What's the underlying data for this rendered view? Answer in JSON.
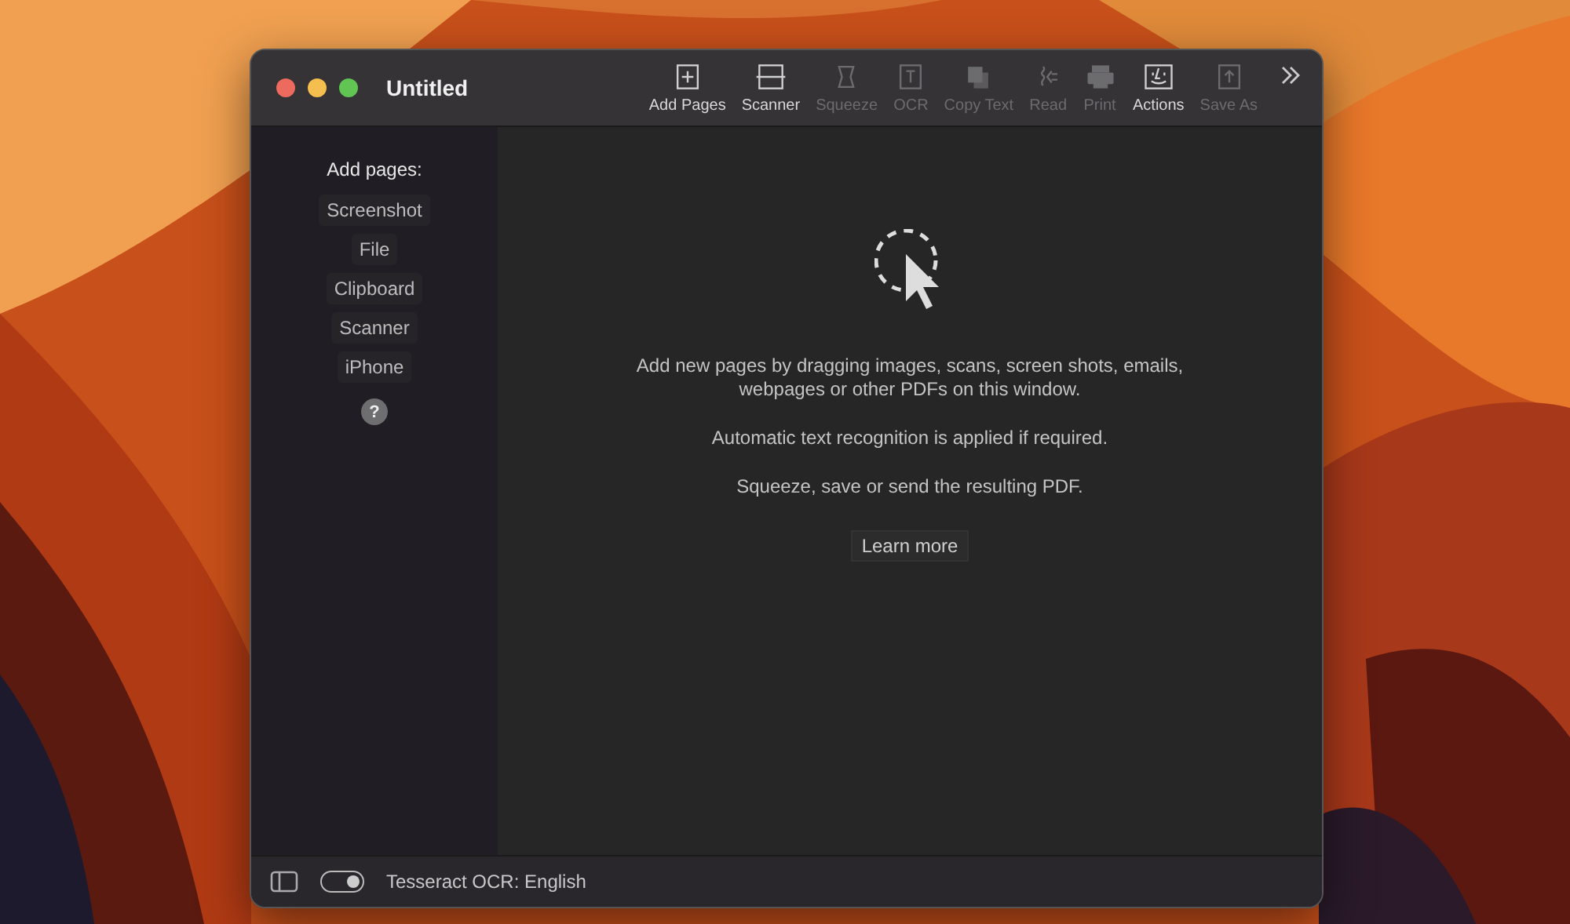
{
  "window": {
    "title": "Untitled"
  },
  "toolbar": [
    {
      "label": "Add Pages",
      "disabled": false
    },
    {
      "label": "Scanner",
      "disabled": false
    },
    {
      "label": "Squeeze",
      "disabled": true
    },
    {
      "label": "OCR",
      "disabled": true
    },
    {
      "label": "Copy Text",
      "disabled": true
    },
    {
      "label": "Read",
      "disabled": true
    },
    {
      "label": "Print",
      "disabled": true
    },
    {
      "label": "Actions",
      "disabled": false
    },
    {
      "label": "Save As",
      "disabled": true
    }
  ],
  "sidebar": {
    "heading": "Add pages:",
    "items": [
      "Screenshot",
      "File",
      "Clipboard",
      "Scanner",
      "iPhone"
    ],
    "help": "?"
  },
  "content": {
    "paragraphs": [
      "Add new pages by dragging images, scans, screen shots, emails, webpages or other PDFs on this window.",
      "Automatic text recognition is applied if required.",
      "Squeeze, save or send the resulting PDF."
    ],
    "button": "Learn more"
  },
  "status_bar": {
    "ocr_toggle": {
      "on": true
    },
    "label": "Tesseract OCR: English"
  }
}
